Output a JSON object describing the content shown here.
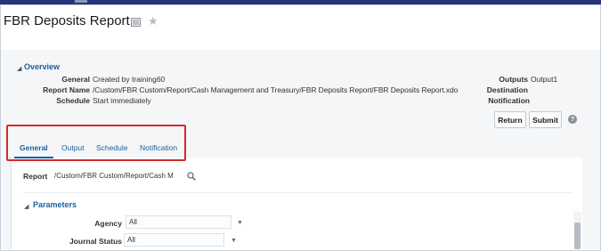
{
  "header": {
    "title": "FBR Deposits Report",
    "print_icon": "print-icon",
    "favorite_icon": "star-icon"
  },
  "overview": {
    "toggle_glyph": "◢",
    "title": "Overview",
    "general_label": "General",
    "general_value": "Created by training60",
    "report_name_label": "Report Name",
    "report_name_value": "/Custom/FBR Custom/Report/Cash Management and Treasury/FBR Deposits Report/FBR Deposits Report.xdo",
    "schedule_label": "Schedule",
    "schedule_value": "Start immediately",
    "outputs_label": "Outputs",
    "outputs_value": "Output1",
    "destination_label": "Destination",
    "notification_label": "Notification"
  },
  "actions": {
    "return_label": "Return",
    "submit_label": "Submit",
    "help_glyph": "?"
  },
  "tabs": [
    {
      "label": "General",
      "active": true
    },
    {
      "label": "Output",
      "active": false
    },
    {
      "label": "Schedule",
      "active": false
    },
    {
      "label": "Notification",
      "active": false
    }
  ],
  "general_tab": {
    "report_label": "Report",
    "report_value": "/Custom/FBR Custom/Report/Cash M",
    "search_icon": "search-icon"
  },
  "parameters": {
    "toggle_glyph": "◢",
    "title": "Parameters",
    "fields": [
      {
        "label": "Agency",
        "value": "All",
        "arrow": "▼"
      },
      {
        "label": "Journal Status",
        "value": "All",
        "arrow": "▼"
      }
    ]
  },
  "colors": {
    "topbar": "#27337a",
    "link_blue": "#1a5e9e",
    "highlight_red": "#d42a2a",
    "page_background": "#f4f6f8"
  }
}
